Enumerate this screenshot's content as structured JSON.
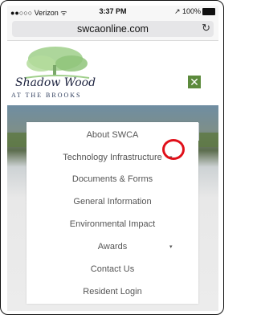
{
  "status_bar": {
    "carrier": "●●○○○ Verizon ᯤ",
    "time": "3:37 PM",
    "battery": "↗ 100%"
  },
  "browser": {
    "url": "swcaonline.com",
    "reload_icon": "reload-icon"
  },
  "header": {
    "logo_script": "Shadow Wood",
    "logo_subtitle": "AT THE BROOKS",
    "menu_close_icon": "close-icon",
    "menu_close_glyph": "✕",
    "accent_color": "#5c8a3c"
  },
  "nav": {
    "items": [
      {
        "label": "About SWCA",
        "has_submenu": false
      },
      {
        "label": "Technology Infrastructure",
        "has_submenu": true
      },
      {
        "label": "Documents & Forms",
        "has_submenu": false
      },
      {
        "label": "General Information",
        "has_submenu": false
      },
      {
        "label": "Environmental Impact",
        "has_submenu": false
      },
      {
        "label": "Awards",
        "has_submenu": true
      },
      {
        "label": "Contact Us",
        "has_submenu": false
      },
      {
        "label": "Resident Login",
        "has_submenu": false
      }
    ],
    "caret_glyph": "▾",
    "highlight_color": "#e0101a"
  }
}
